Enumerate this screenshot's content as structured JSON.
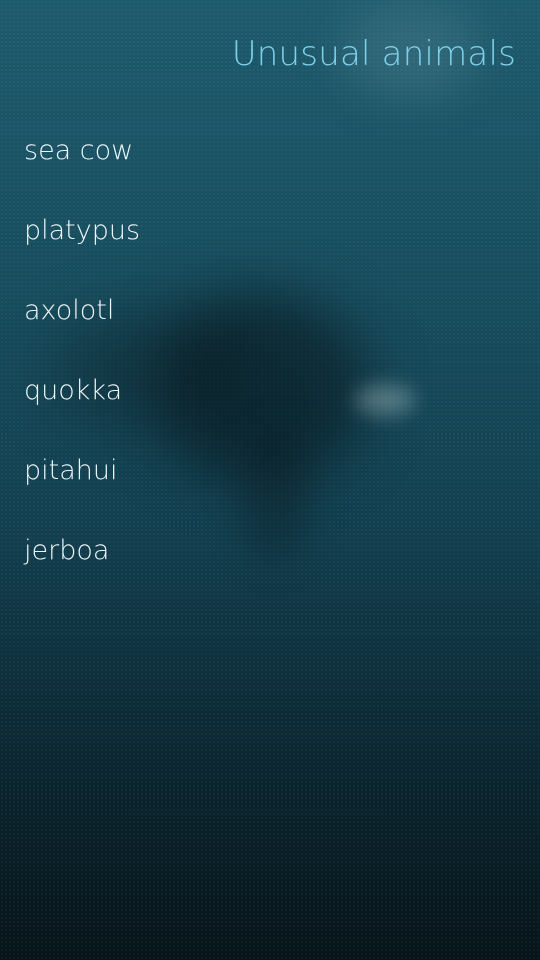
{
  "header": {
    "title": "Unusual animals"
  },
  "list": {
    "items": [
      {
        "label": "sea cow"
      },
      {
        "label": "platypus"
      },
      {
        "label": "axolotl"
      },
      {
        "label": "quokka"
      },
      {
        "label": "pitahui"
      },
      {
        "label": "jerboa"
      }
    ]
  },
  "colors": {
    "title": "#7fd0ea",
    "item_text": "#eef6f8",
    "background_top": "#1d5a6c",
    "background_bottom": "#061419"
  }
}
